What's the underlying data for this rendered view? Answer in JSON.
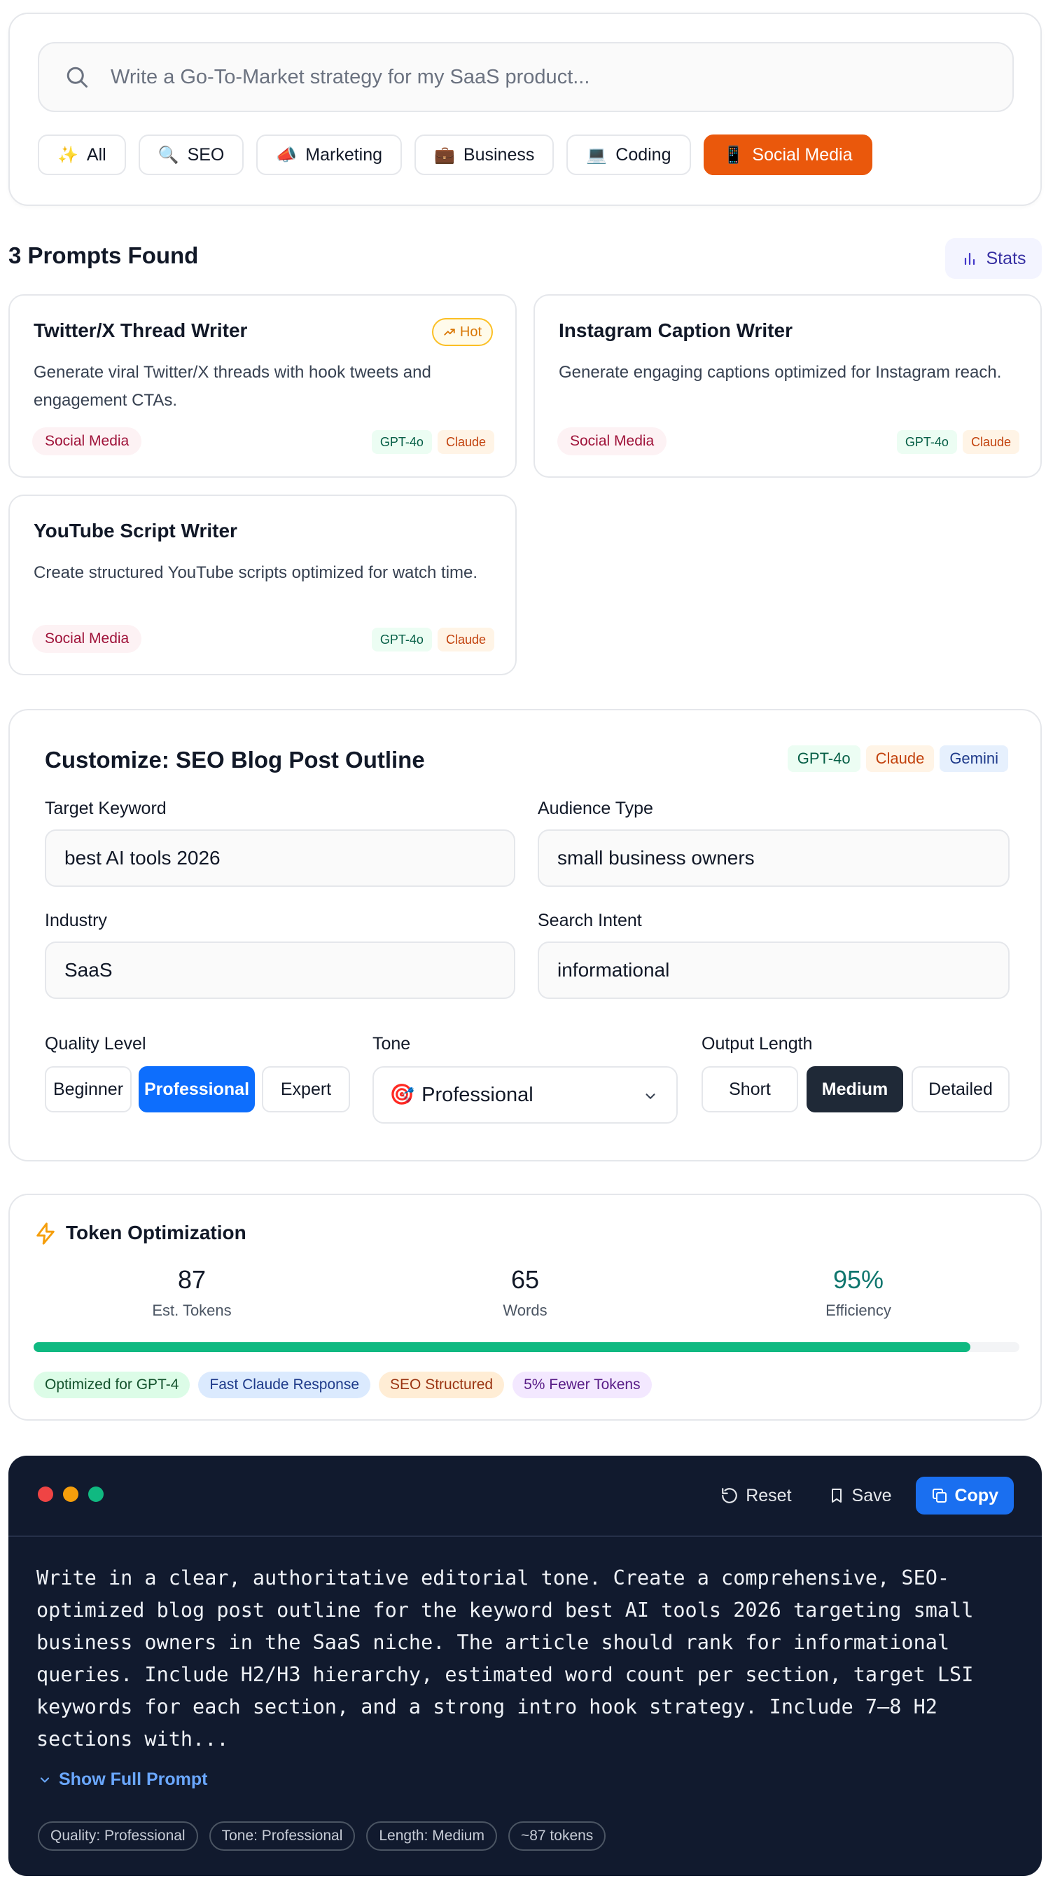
{
  "search": {
    "placeholder": "Write a Go-To-Market strategy for my SaaS product...",
    "categories": [
      {
        "icon": "sparkles-icon",
        "emoji": "✨",
        "label": "All"
      },
      {
        "icon": "magnifier-icon",
        "emoji": "🔍",
        "label": "SEO"
      },
      {
        "icon": "megaphone-icon",
        "emoji": "📣",
        "label": "Marketing"
      },
      {
        "icon": "briefcase-icon",
        "emoji": "💼",
        "label": "Business"
      },
      {
        "icon": "laptop-icon",
        "emoji": "💻",
        "label": "Coding"
      },
      {
        "icon": "phone-icon",
        "emoji": "📱",
        "label": "Social Media",
        "active": true
      }
    ]
  },
  "results": {
    "title": "3 Prompts Found",
    "stats_label": "Stats",
    "cards": [
      {
        "title": "Twitter/X Thread Writer",
        "hot": "Hot",
        "description": "Generate viral Twitter/X threads with hook tweets and engagement CTAs.",
        "category": "Social Media",
        "models": [
          "GPT-4o",
          "Claude"
        ]
      },
      {
        "title": "Instagram Caption Writer",
        "description": "Generate engaging captions optimized for Instagram reach.",
        "category": "Social Media",
        "models": [
          "GPT-4o",
          "Claude"
        ]
      },
      {
        "title": "YouTube Script Writer",
        "description": "Create structured YouTube scripts optimized for watch time.",
        "category": "Social Media",
        "models": [
          "GPT-4o",
          "Claude"
        ]
      }
    ]
  },
  "customize": {
    "title": "Customize: SEO Blog Post Outline",
    "models": [
      "GPT-4o",
      "Claude",
      "Gemini"
    ],
    "fields": {
      "keyword": {
        "label": "Target Keyword",
        "value": "best AI tools 2026"
      },
      "audience": {
        "label": "Audience Type",
        "value": "small business owners"
      },
      "industry": {
        "label": "Industry",
        "value": "SaaS"
      },
      "intent": {
        "label": "Search Intent",
        "value": "informational"
      }
    },
    "quality": {
      "label": "Quality Level",
      "options": [
        "Beginner",
        "Professional",
        "Expert"
      ],
      "selected": "Professional"
    },
    "tone": {
      "label": "Tone",
      "emoji": "🎯",
      "value": "Professional"
    },
    "length": {
      "label": "Output Length",
      "options": [
        "Short",
        "Medium",
        "Detailed"
      ],
      "selected": "Medium"
    }
  },
  "tokens": {
    "title": "Token Optimization",
    "est_tokens": "87",
    "est_tokens_label": "Est. Tokens",
    "words": "65",
    "words_label": "Words",
    "efficiency": "95%",
    "efficiency_label": "Efficiency",
    "efficiency_fraction": 0.95,
    "badges": [
      "Optimized for GPT-4",
      "Fast Claude Response",
      "SEO Structured",
      "5% Fewer Tokens"
    ]
  },
  "output": {
    "reset_label": "Reset",
    "save_label": "Save",
    "copy_label": "Copy",
    "lines": [
      "Write in a clear, authoritative editorial tone. Create a comprehensive, SEO-",
      "optimized blog post outline for the keyword best AI tools 2026 targeting small",
      "business owners in the SaaS niche. The article should rank for informational",
      "queries. Include H2/H3 hierarchy, estimated word count per section, target LSI",
      "keywords for each section, and a strong intro hook strategy. Include 7–8 H2",
      "sections with..."
    ],
    "show_full_label": "Show Full Prompt",
    "meta": [
      "Quality: Professional",
      "Tone: Professional",
      "Length: Medium",
      "~87 tokens"
    ]
  },
  "colors": {
    "accent_orange": "#ea580c",
    "accent_blue": "#0d6efd",
    "efficiency_green": "#10b981",
    "output_bg": "#111a2e"
  }
}
